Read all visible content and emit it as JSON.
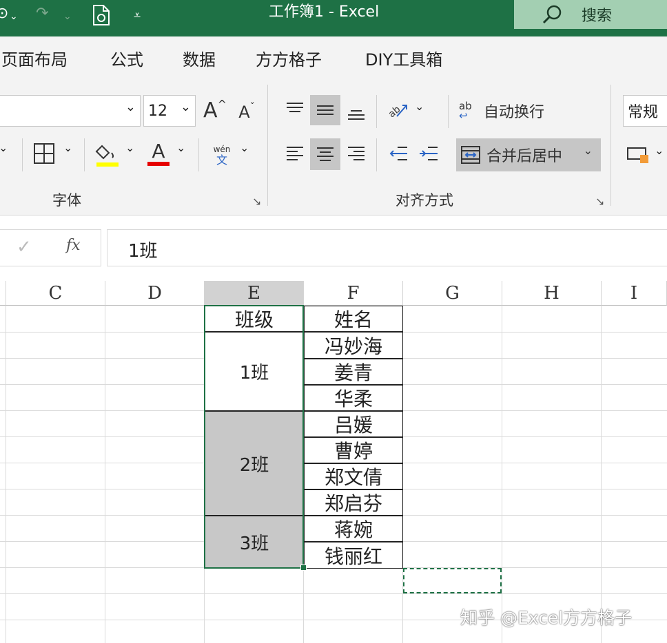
{
  "window": {
    "title": "工作簿1  -  Excel",
    "search_label": "搜索"
  },
  "ribbon": {
    "tabs": [
      "页面布局",
      "公式",
      "数据",
      "方方格子",
      "DIY工具箱"
    ],
    "font": {
      "size_value": "12",
      "grow_label": "A",
      "shrink_label": "A",
      "font_color_label": "A",
      "phonetic_top": "wén",
      "phonetic_bottom": "文",
      "group_label": "字体"
    },
    "alignment": {
      "wrap_text_label": "自动换行",
      "wrap_icon_text": "ab",
      "merge_center_label": "合并后居中",
      "group_label": "对齐方式"
    },
    "number": {
      "format_value": "常规"
    }
  },
  "formula_bar": {
    "fx_label": "fx",
    "value": "1班"
  },
  "sheet": {
    "columns": [
      "C",
      "D",
      "E",
      "F",
      "G",
      "H",
      "I"
    ],
    "header_row": {
      "E": "班级",
      "F": "姓名"
    },
    "classes": [
      "1班",
      "2班",
      "3班"
    ],
    "names": [
      "冯妙海",
      "姜青",
      "华柔",
      "吕媛",
      "曹婷",
      "郑文倩",
      "郑启芬",
      "蒋婉",
      "钱丽红"
    ],
    "colors": {
      "merged_fill": "#c8c8c8",
      "selection": "#1e7145"
    }
  },
  "watermark": "知乎 @Excel方方格子"
}
